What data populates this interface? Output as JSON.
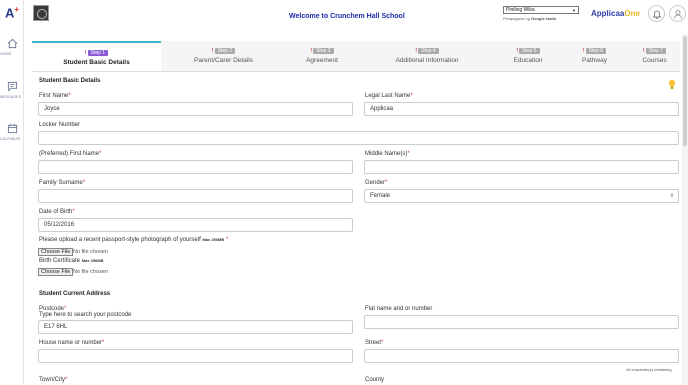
{
  "rail": {
    "logo": "A",
    "logo_plus": "+",
    "home": "HOME",
    "messages": "MESSAGES",
    "calendar": "CALENDAR"
  },
  "header": {
    "welcome": "Welcome to Crunchem Hall School",
    "language": "Piniling Wika",
    "powered_prefix": "Pinapagana ng",
    "powered_google": "Google",
    "powered_suffix": "Isalin",
    "brand_a": "Applicaa",
    "brand_b": "One"
  },
  "tabs": [
    {
      "step": "Step 1",
      "name": "Student Basic Details"
    },
    {
      "step": "Step 2",
      "name": "Parent/Carer Details"
    },
    {
      "step": "Step 3",
      "name": "Agreement"
    },
    {
      "step": "Step 4",
      "name": "Additional Information"
    },
    {
      "step": "Step 5",
      "name": "Education"
    },
    {
      "step": "Step 6",
      "name": "Pathway"
    },
    {
      "step": "Step 7",
      "name": "Courses"
    }
  ],
  "form": {
    "section_basic": "Student Basic Details",
    "first_name_label": "First Name",
    "first_name_value": "Joyce",
    "legal_last_name_label": "Legal Last Name",
    "legal_last_name_value": "Applicaa",
    "locker_label": "Locker Number",
    "preferred_label": "(Preferred) First Name",
    "middle_label": "Middle Name(s)",
    "family_label": "Family Surname",
    "gender_label": "Gender",
    "gender_value": "Female",
    "dob_label": "Date of Birth",
    "dob_value": "05/12/2016",
    "photo_label": "Please upload a recent passport-style photograph of yourself",
    "photo_max": "Max 250MB",
    "choose_file": "Choose File",
    "no_file": "No file chosen",
    "birth_cert_label": "Birth Certificate",
    "birth_cert_max": "Max 250MB",
    "section_address": "Student Current Address",
    "postcode_label": "Postcode",
    "postcode_hint": "Type here to search your postcode",
    "postcode_value": "E17 6HL",
    "flat_label": "Flat name and or number",
    "house_label": "House name or number",
    "street_label": "Street",
    "remaining": "40 character(s) remaining",
    "town_label": "Town/City",
    "county_label": "County"
  },
  "colors": {
    "accent": "#3bb6c9",
    "active_badge": "#8a5ad6",
    "brand": "#2e3ca8",
    "required": "#c0392b"
  }
}
